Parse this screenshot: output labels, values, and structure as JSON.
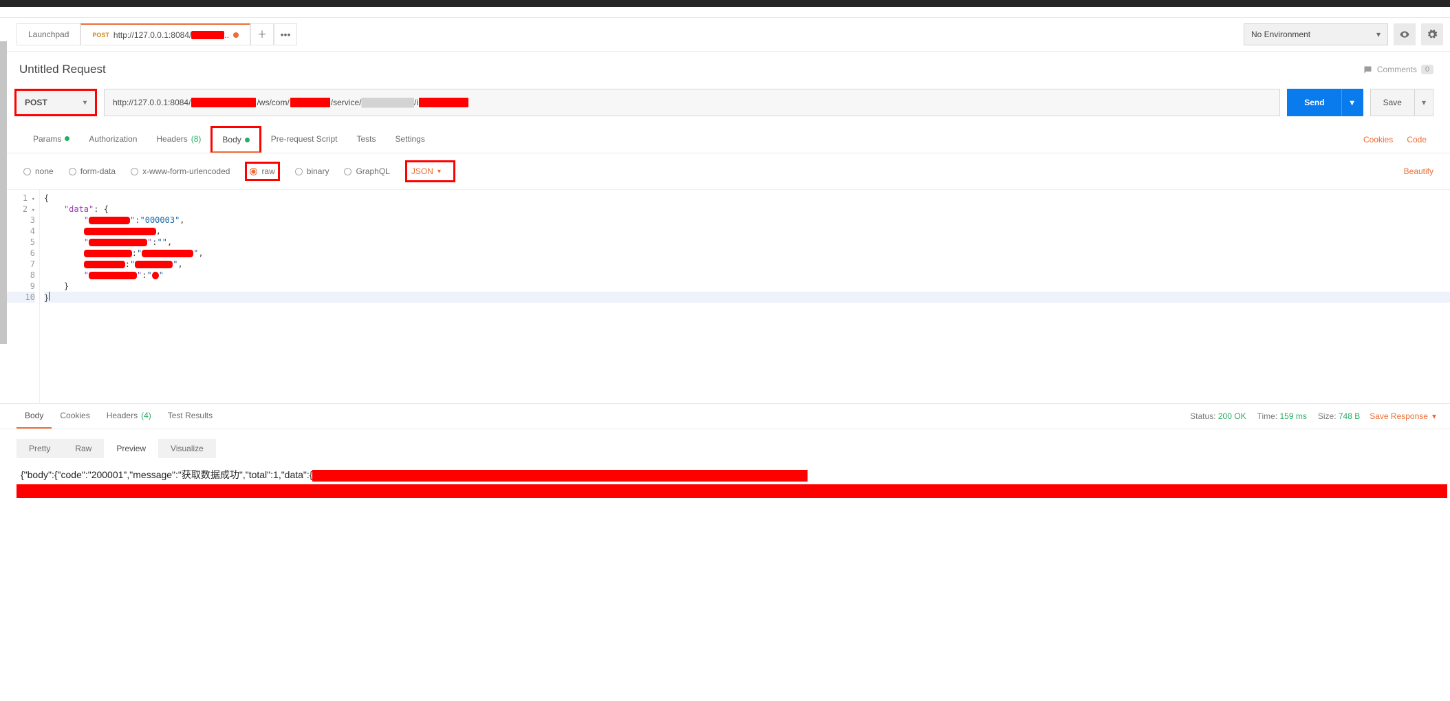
{
  "header": {
    "tabs": [
      {
        "label": "Launchpad"
      },
      {
        "method": "POST",
        "url_prefix": "http://127.0.0.1:8084/",
        "has_dot": true
      }
    ],
    "env_label": "No Environment"
  },
  "request": {
    "title": "Untitled Request",
    "comments_label": "Comments",
    "comments_count": "0",
    "method": "POST",
    "url_prefix": "http://127.0.0.1:8084/",
    "url_mid1": "/ws/com/",
    "url_mid2": "/service/",
    "url_mid3": "/i",
    "send_label": "Send",
    "save_label": "Save",
    "tabs": {
      "params": "Params",
      "auth": "Authorization",
      "headers": "Headers",
      "headers_count": "(8)",
      "body": "Body",
      "prerequest": "Pre-request Script",
      "tests": "Tests",
      "settings": "Settings",
      "cookies": "Cookies",
      "code": "Code"
    },
    "body_options": {
      "none": "none",
      "formdata": "form-data",
      "urlencoded": "x-www-form-urlencoded",
      "raw": "raw",
      "binary": "binary",
      "graphql": "GraphQL",
      "format": "JSON",
      "beautify": "Beautify"
    },
    "editor": {
      "line1": "{",
      "line2_key": "\"data\"",
      "line2_sep": ": {",
      "line3_val": "\"000003\"",
      "line9": "    }",
      "line10": "}"
    }
  },
  "response": {
    "tabs": {
      "body": "Body",
      "cookies": "Cookies",
      "headers": "Headers",
      "headers_count": "(4)",
      "tests": "Test Results"
    },
    "meta": {
      "status_label": "Status:",
      "status_value": "200 OK",
      "time_label": "Time:",
      "time_value": "159 ms",
      "size_label": "Size:",
      "size_value": "748 B",
      "save": "Save Response"
    },
    "views": {
      "pretty": "Pretty",
      "raw": "Raw",
      "preview": "Preview",
      "visualize": "Visualize"
    },
    "body_text": "{\"body\":{\"code\":\"200001\",\"message\":\"获取数据成功\",\"total\":1,\"data\":{"
  }
}
